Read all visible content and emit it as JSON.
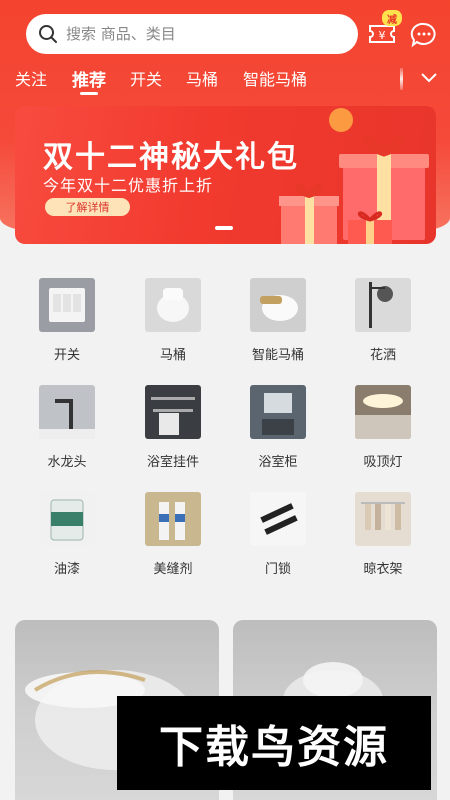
{
  "search": {
    "placeholder": "搜索 商品、类目",
    "icon": "search-icon"
  },
  "header": {
    "coupon_badge": "减",
    "coupon_icon": "coupon-icon",
    "message_icon": "message-icon"
  },
  "tabs": [
    {
      "label": "关注"
    },
    {
      "label": "推荐"
    },
    {
      "label": "开关"
    },
    {
      "label": "马桶"
    },
    {
      "label": "智能马桶"
    }
  ],
  "banner": {
    "title": "双十二神秘大礼包",
    "subtitle": "今年双十二优惠折上折",
    "button": "了解详情"
  },
  "categories": [
    {
      "label": "开关"
    },
    {
      "label": "马桶"
    },
    {
      "label": "智能马桶"
    },
    {
      "label": "花洒"
    },
    {
      "label": "水龙头"
    },
    {
      "label": "浴室挂件"
    },
    {
      "label": "浴室柜"
    },
    {
      "label": "吸顶灯"
    },
    {
      "label": "油漆"
    },
    {
      "label": "美缝剂"
    },
    {
      "label": "门锁"
    },
    {
      "label": "晾衣架"
    }
  ],
  "watermark": "下载鸟资源",
  "colors": {
    "brand": "#f4442e",
    "text": "#333333",
    "background": "#f2f2f2"
  }
}
